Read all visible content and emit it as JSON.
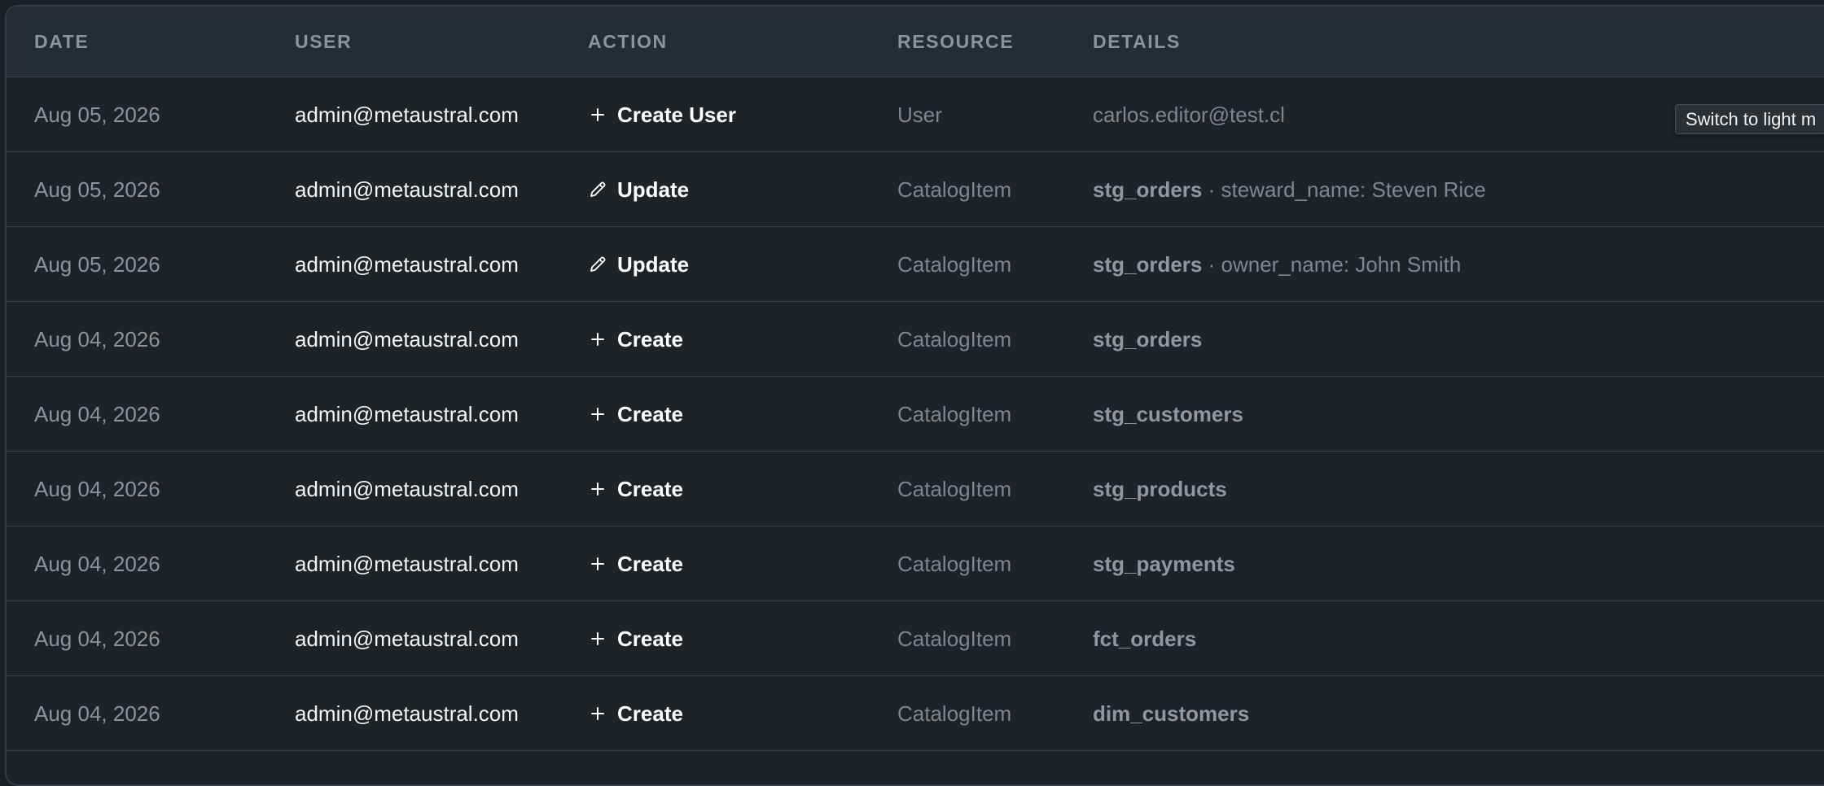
{
  "table": {
    "headers": {
      "date": "DATE",
      "user": "USER",
      "action": "ACTION",
      "resource": "RESOURCE",
      "details": "DETAILS"
    },
    "rows": [
      {
        "date": "Aug 05, 2026",
        "user": "admin@metaustral.com",
        "action_icon": "plus-icon",
        "action": "Create User",
        "resource": "User",
        "detail_name": "",
        "detail_sep": "",
        "detail_extra": "carlos.editor@test.cl"
      },
      {
        "date": "Aug 05, 2026",
        "user": "admin@metaustral.com",
        "action_icon": "pencil-icon",
        "action": "Update",
        "resource": "CatalogItem",
        "detail_name": "stg_orders",
        "detail_sep": " · ",
        "detail_extra": "steward_name: Steven Rice"
      },
      {
        "date": "Aug 05, 2026",
        "user": "admin@metaustral.com",
        "action_icon": "pencil-icon",
        "action": "Update",
        "resource": "CatalogItem",
        "detail_name": "stg_orders",
        "detail_sep": " · ",
        "detail_extra": "owner_name: John Smith"
      },
      {
        "date": "Aug 04, 2026",
        "user": "admin@metaustral.com",
        "action_icon": "plus-icon",
        "action": "Create",
        "resource": "CatalogItem",
        "detail_name": "stg_orders",
        "detail_sep": "",
        "detail_extra": ""
      },
      {
        "date": "Aug 04, 2026",
        "user": "admin@metaustral.com",
        "action_icon": "plus-icon",
        "action": "Create",
        "resource": "CatalogItem",
        "detail_name": "stg_customers",
        "detail_sep": "",
        "detail_extra": ""
      },
      {
        "date": "Aug 04, 2026",
        "user": "admin@metaustral.com",
        "action_icon": "plus-icon",
        "action": "Create",
        "resource": "CatalogItem",
        "detail_name": "stg_products",
        "detail_sep": "",
        "detail_extra": ""
      },
      {
        "date": "Aug 04, 2026",
        "user": "admin@metaustral.com",
        "action_icon": "plus-icon",
        "action": "Create",
        "resource": "CatalogItem",
        "detail_name": "stg_payments",
        "detail_sep": "",
        "detail_extra": ""
      },
      {
        "date": "Aug 04, 2026",
        "user": "admin@metaustral.com",
        "action_icon": "plus-icon",
        "action": "Create",
        "resource": "CatalogItem",
        "detail_name": "fct_orders",
        "detail_sep": "",
        "detail_extra": ""
      },
      {
        "date": "Aug 04, 2026",
        "user": "admin@metaustral.com",
        "action_icon": "plus-icon",
        "action": "Create",
        "resource": "CatalogItem",
        "detail_name": "dim_customers",
        "detail_sep": "",
        "detail_extra": ""
      }
    ]
  },
  "tooltip": {
    "text": "Switch to light m"
  }
}
